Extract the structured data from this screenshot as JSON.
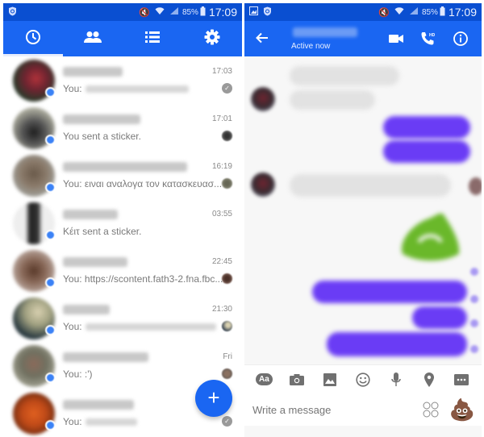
{
  "status_bar": {
    "battery": "85%",
    "time": "17:09"
  },
  "colors": {
    "primary": "#1a66f2",
    "status_bar": "#0a4fd1",
    "outgoing_bubble": "#6a3cf5",
    "incoming_bubble": "#e2e2e2",
    "fab": "#1a66f2"
  },
  "left": {
    "tabs": [
      {
        "name": "recent",
        "icon": "clock-icon",
        "active": true
      },
      {
        "name": "people",
        "icon": "people-icon",
        "active": false
      },
      {
        "name": "groups",
        "icon": "list-icon",
        "active": false
      },
      {
        "name": "settings",
        "icon": "gear-icon",
        "active": false
      }
    ],
    "conversations": [
      {
        "time": "17:03",
        "prefix": "You:",
        "snippet": "",
        "receipt": "check"
      },
      {
        "time": "17:01",
        "prefix": "",
        "snippet": "You sent a sticker.",
        "receipt": "face"
      },
      {
        "time": "16:19",
        "prefix": "",
        "snippet": "You: ειναι αναλογα τον κατασκευασ...",
        "receipt": "face"
      },
      {
        "time": "03:55",
        "prefix": "",
        "snippet": "Κέιτ sent a sticker.",
        "receipt": "none"
      },
      {
        "time": "22:45",
        "prefix": "",
        "snippet": "You: https://scontent.fath3-2.fna.fbc...",
        "receipt": "face"
      },
      {
        "time": "21:30",
        "prefix": "You:",
        "snippet": "",
        "receipt": "face"
      },
      {
        "time": "Fri",
        "prefix": "",
        "snippet": "You: :')",
        "receipt": "face"
      },
      {
        "time": "",
        "prefix": "You:",
        "snippet": "",
        "receipt": "check"
      }
    ],
    "fab_label": "+"
  },
  "right": {
    "active_status": "Active now",
    "composer": {
      "placeholder": "Write a message",
      "tools": [
        "text-style",
        "camera",
        "gallery",
        "emoji",
        "microphone",
        "location",
        "more"
      ],
      "text_style_label": "Aa",
      "like_emoji": "💩"
    }
  }
}
